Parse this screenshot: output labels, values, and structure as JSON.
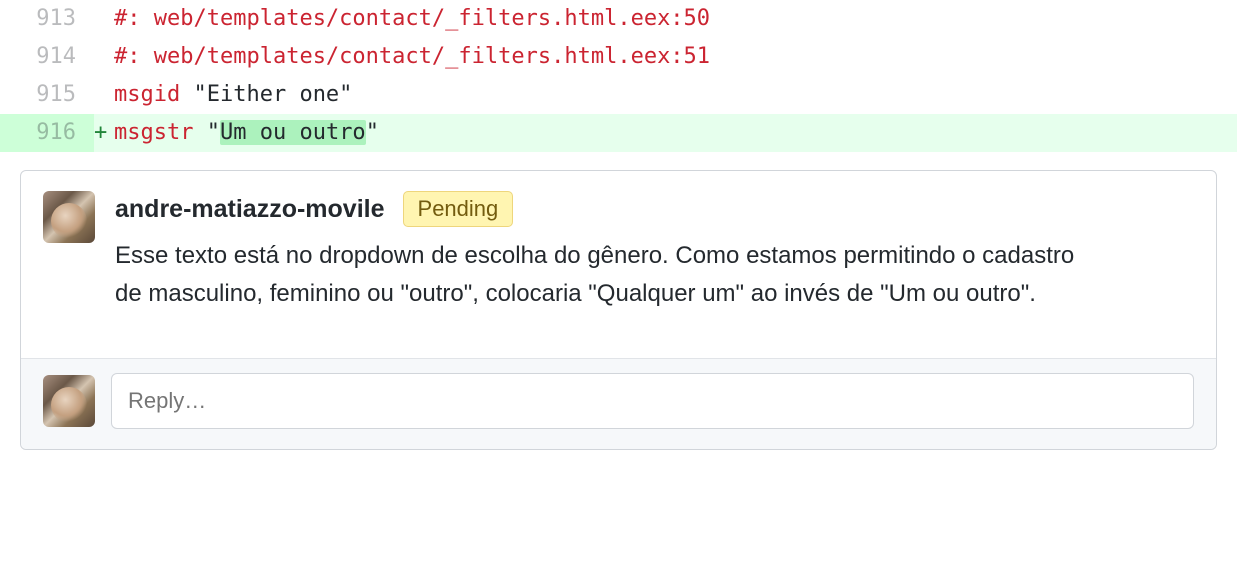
{
  "diff": {
    "lines": [
      {
        "num": "913",
        "marker": " ",
        "addition": false,
        "tokens": [
          {
            "text": "#:",
            "class": "code-red",
            "hl": false
          },
          {
            "text": " ",
            "class": "code-dark",
            "hl": false
          },
          {
            "text": "web/templates/contact/_filters.html.eex:50",
            "class": "code-red",
            "hl": false
          }
        ]
      },
      {
        "num": "914",
        "marker": " ",
        "addition": false,
        "tokens": [
          {
            "text": "#:",
            "class": "code-red",
            "hl": false
          },
          {
            "text": " ",
            "class": "code-dark",
            "hl": false
          },
          {
            "text": "web/templates/contact/_filters.html.eex:51",
            "class": "code-red",
            "hl": false
          }
        ]
      },
      {
        "num": "915",
        "marker": " ",
        "addition": false,
        "tokens": [
          {
            "text": "msgid",
            "class": "code-red",
            "hl": false
          },
          {
            "text": " ",
            "class": "code-dark",
            "hl": false
          },
          {
            "text": "\"Either one\"",
            "class": "code-dark",
            "hl": false
          }
        ]
      },
      {
        "num": "916",
        "marker": "+",
        "addition": true,
        "tokens": [
          {
            "text": "msgstr",
            "class": "code-red",
            "hl": false
          },
          {
            "text": " ",
            "class": "code-dark",
            "hl": false
          },
          {
            "text": "\"",
            "class": "code-dark",
            "hl": false
          },
          {
            "text": "Um ou outro",
            "class": "code-dark",
            "hl": true
          },
          {
            "text": "\"",
            "class": "code-dark",
            "hl": false
          }
        ]
      }
    ]
  },
  "comment": {
    "author": "andre-matiazzo-movile",
    "badge": "Pending",
    "text": "Esse texto está no dropdown de escolha do gênero. Como estamos permitindo o cadastro de masculino, feminino ou \"outro\", colocaria \"Qualquer um\" ao invés de \"Um ou outro\"."
  },
  "reply": {
    "placeholder": "Reply…"
  }
}
